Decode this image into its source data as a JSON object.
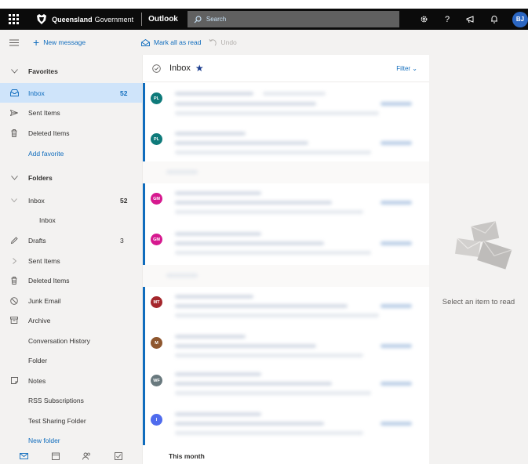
{
  "header": {
    "brand_bold": "Queensland",
    "brand_rest": "Government",
    "app_name": "Outlook",
    "search_placeholder": "Search",
    "icons": [
      "settings-icon",
      "help-icon",
      "feedback-icon",
      "notifications-icon"
    ],
    "avatar_initials": "BJ"
  },
  "commands": {
    "new_message": "New message",
    "mark_all_read": "Mark all as read",
    "undo": "Undo"
  },
  "nav": {
    "favorites_label": "Favorites",
    "favorites": [
      {
        "label": "Inbox",
        "count": "52",
        "icon": "inbox-icon",
        "selected": true
      },
      {
        "label": "Sent Items",
        "count": "",
        "icon": "send-icon"
      },
      {
        "label": "Deleted Items",
        "count": "",
        "icon": "trash-icon"
      }
    ],
    "add_favorite": "Add favorite",
    "folders_label": "Folders",
    "folders": [
      {
        "label": "Inbox",
        "count": "52",
        "icon": "chevron-down-icon"
      },
      {
        "label": "Inbox",
        "count": "",
        "icon": ""
      },
      {
        "label": "Drafts",
        "count": "3",
        "icon": "pencil-icon"
      },
      {
        "label": "Sent Items",
        "count": "",
        "icon": "chevron-right-icon"
      },
      {
        "label": "Deleted Items",
        "count": "",
        "icon": "trash-icon"
      },
      {
        "label": "Junk Email",
        "count": "",
        "icon": "block-icon"
      },
      {
        "label": "Archive",
        "count": "",
        "icon": "archive-icon"
      },
      {
        "label": "Conversation History",
        "count": "",
        "icon": ""
      },
      {
        "label": "Folder",
        "count": "",
        "icon": ""
      },
      {
        "label": "Notes",
        "count": "",
        "icon": "note-icon"
      },
      {
        "label": "RSS Subscriptions",
        "count": "",
        "icon": ""
      },
      {
        "label": "Test Sharing Folder",
        "count": "",
        "icon": ""
      }
    ],
    "new_folder": "New folder",
    "bottom_icons": [
      "mail-icon",
      "calendar-icon",
      "people-icon",
      "todo-icon"
    ]
  },
  "list": {
    "title": "Inbox",
    "filter": "Filter",
    "messages": [
      {
        "initials": "PL",
        "color": "#0e7a7a"
      },
      {
        "initials": "PL",
        "color": "#0e7a7a"
      },
      {
        "initials": "GM",
        "color": "#d6198f"
      },
      {
        "initials": "GM",
        "color": "#d6198f"
      },
      {
        "initials": "MT",
        "color": "#a4262c"
      },
      {
        "initials": "M",
        "color": "#8e562e"
      },
      {
        "initials": "WF",
        "color": "#69797e"
      },
      {
        "initials": "I",
        "color": "#4f6bed"
      }
    ],
    "group_label": "This month"
  },
  "reading": {
    "empty_message": "Select an item to read"
  },
  "colors": {
    "accent": "#0f6cbd",
    "selected_bg": "#cfe4fa",
    "header_bg": "#0b0b0b"
  }
}
